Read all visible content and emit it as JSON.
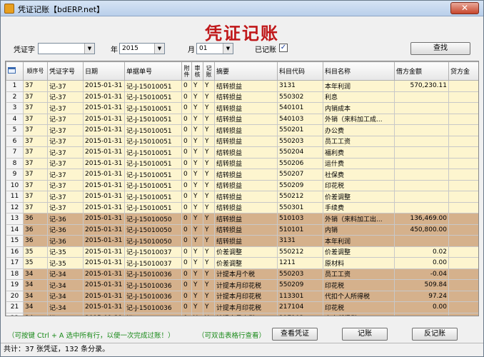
{
  "window": {
    "title": "凭证记账【bdERP.net】",
    "close_label": "✕"
  },
  "heading": "凭证记账",
  "filters": {
    "voucher_word_label": "凭证字",
    "voucher_word_value": "",
    "year_label": "年",
    "year_value": "2015",
    "month_label": "月",
    "month_value": "01",
    "posted_label": "已记账",
    "posted_checked": "✓",
    "search_button": "查找"
  },
  "table": {
    "headers": [
      "",
      "顺序号",
      "凭证字号",
      "日期",
      "单据单号",
      "附件",
      "审核",
      "记账",
      "摘要",
      "科目代码",
      "科目名称",
      "借方金额",
      "贷方金"
    ],
    "rows": [
      {
        "style": "y",
        "cells": [
          "1",
          "37",
          "记-37",
          "2015-01-31",
          "记-J-15010051",
          "0",
          "Y",
          "Y",
          "结转损益",
          "3131",
          "本年利润",
          "570,230.11",
          ""
        ]
      },
      {
        "style": "y",
        "cells": [
          "2",
          "37",
          "记-37",
          "2015-01-31",
          "记-J-15010051",
          "0",
          "Y",
          "Y",
          "结转损益",
          "550302",
          "利息",
          "",
          ""
        ]
      },
      {
        "style": "y",
        "cells": [
          "3",
          "37",
          "记-37",
          "2015-01-31",
          "记-J-15010051",
          "0",
          "Y",
          "Y",
          "结转损益",
          "540101",
          "内销成本",
          "",
          "3"
        ]
      },
      {
        "style": "y",
        "cells": [
          "4",
          "37",
          "记-37",
          "2015-01-31",
          "记-J-15010051",
          "0",
          "Y",
          "Y",
          "结转损益",
          "540103",
          "外销（来料加工成...",
          "",
          "13"
        ]
      },
      {
        "style": "y",
        "cells": [
          "5",
          "37",
          "记-37",
          "2015-01-31",
          "记-J-15010051",
          "0",
          "Y",
          "Y",
          "结转损益",
          "550201",
          "办公费",
          "",
          ""
        ]
      },
      {
        "style": "y",
        "cells": [
          "6",
          "37",
          "记-37",
          "2015-01-31",
          "记-J-15010051",
          "0",
          "Y",
          "Y",
          "结转损益",
          "550203",
          "员工工资",
          "",
          "2"
        ]
      },
      {
        "style": "y",
        "cells": [
          "7",
          "37",
          "记-37",
          "2015-01-31",
          "记-J-15010051",
          "0",
          "Y",
          "Y",
          "结转损益",
          "550204",
          "福利费",
          "",
          ""
        ]
      },
      {
        "style": "y",
        "cells": [
          "8",
          "37",
          "记-37",
          "2015-01-31",
          "记-J-15010051",
          "0",
          "Y",
          "Y",
          "结转损益",
          "550206",
          "运什费",
          "",
          ""
        ]
      },
      {
        "style": "y",
        "cells": [
          "9",
          "37",
          "记-37",
          "2015-01-31",
          "记-J-15010051",
          "0",
          "Y",
          "Y",
          "结转损益",
          "550207",
          "社保费",
          "",
          ""
        ]
      },
      {
        "style": "y",
        "cells": [
          "10",
          "37",
          "记-37",
          "2015-01-31",
          "记-J-15010051",
          "0",
          "Y",
          "Y",
          "结转损益",
          "550209",
          "印花税",
          "",
          ""
        ]
      },
      {
        "style": "y",
        "cells": [
          "11",
          "37",
          "记-37",
          "2015-01-31",
          "记-J-15010051",
          "0",
          "Y",
          "Y",
          "结转损益",
          "550212",
          "价差调整",
          "",
          ""
        ]
      },
      {
        "style": "y",
        "cells": [
          "12",
          "37",
          "记-37",
          "2015-01-31",
          "记-J-15010051",
          "0",
          "Y",
          "Y",
          "结转损益",
          "550301",
          "手续费",
          "",
          ""
        ]
      },
      {
        "style": "b",
        "cells": [
          "13",
          "36",
          "记-36",
          "2015-01-31",
          "记-J-15010050",
          "0",
          "Y",
          "Y",
          "结转损益",
          "510103",
          "外销（来料加工出...",
          "136,469.00",
          ""
        ]
      },
      {
        "style": "b",
        "cells": [
          "14",
          "36",
          "记-36",
          "2015-01-31",
          "记-J-15010050",
          "0",
          "Y",
          "Y",
          "结转损益",
          "510101",
          "内销",
          "450,800.00",
          ""
        ]
      },
      {
        "style": "b",
        "cells": [
          "15",
          "36",
          "记-36",
          "2015-01-31",
          "记-J-15010050",
          "0",
          "Y",
          "Y",
          "结转损益",
          "3131",
          "本年利润",
          "",
          "58"
        ]
      },
      {
        "style": "y",
        "cells": [
          "16",
          "35",
          "记-35",
          "2015-01-31",
          "记-J-15010037",
          "0",
          "Y",
          "Y",
          "价差调整",
          "550212",
          "价差调整",
          "0.02",
          ""
        ]
      },
      {
        "style": "y",
        "cells": [
          "17",
          "35",
          "记-35",
          "2015-01-31",
          "记-J-15010037",
          "0",
          "Y",
          "Y",
          "价差调整",
          "1211",
          "原材料",
          "0.00",
          ""
        ]
      },
      {
        "style": "b",
        "cells": [
          "18",
          "34",
          "记-34",
          "2015-01-31",
          "记-J-15010036",
          "0",
          "Y",
          "Y",
          "计提本月个税",
          "550203",
          "员工工资",
          "-0.04",
          ""
        ]
      },
      {
        "style": "b",
        "cells": [
          "19",
          "34",
          "记-34",
          "2015-01-31",
          "记-J-15010036",
          "0",
          "Y",
          "Y",
          "计提本月印花税",
          "550209",
          "印花税",
          "509.84",
          ""
        ]
      },
      {
        "style": "b",
        "cells": [
          "20",
          "34",
          "记-34",
          "2015-01-31",
          "记-J-15010036",
          "0",
          "Y",
          "Y",
          "计提本月印花税",
          "113301",
          "代扣个人所得税",
          "97.24",
          ""
        ]
      },
      {
        "style": "b",
        "cells": [
          "21",
          "34",
          "记-34",
          "2015-01-31",
          "记-J-15010036",
          "0",
          "Y",
          "Y",
          "计提本月印花税",
          "217104",
          "印花税",
          "0.00",
          ""
        ]
      },
      {
        "style": "b",
        "cells": [
          "22",
          "34",
          "记-34",
          "2015-01-31",
          "记-J-15010036",
          "0",
          "Y",
          "Y",
          "计提本月个税",
          "217102",
          "个人所得税",
          "",
          ""
        ]
      }
    ]
  },
  "hints": {
    "select_all": "（可按键 Ctrl + A 选中所有行，以便一次完成过账！）",
    "double_click": "（可双击表格行查看）"
  },
  "buttons": {
    "view": "查看凭证",
    "post": "记账",
    "unpost": "反记账"
  },
  "status": "共计：37 张凭证，132 条分录。"
}
